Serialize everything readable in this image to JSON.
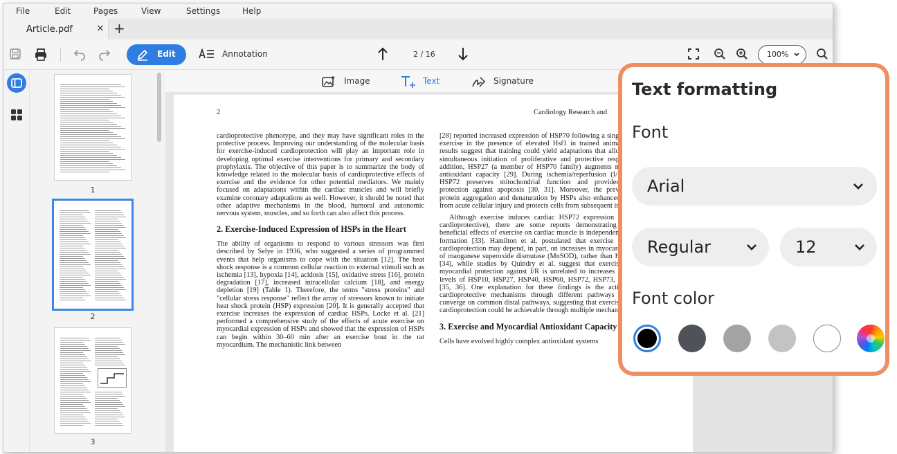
{
  "menu": [
    "File",
    "Edit",
    "Pages",
    "View",
    "Settings",
    "Help"
  ],
  "tab": {
    "title": "Article.pdf",
    "close": "×",
    "new": "+"
  },
  "toolbar": {
    "edit_label": "Edit",
    "annotation_label": "Annotation",
    "page_indicator": "2 / 16",
    "zoom": "100%"
  },
  "thumbnails": [
    {
      "num": "1"
    },
    {
      "num": "2"
    },
    {
      "num": "3"
    }
  ],
  "subtoolbar": {
    "image": "Image",
    "text": "Text",
    "signature": "Signature"
  },
  "page": {
    "number": "2",
    "running_head": "Cardiology Research and",
    "left_col_p1": "cardioprotective phenotype, and they may have significant roles in the protective process. Improving our understanding of the molecular basis for exercise-induced cardioprotection will play an important role in developing optimal exercise interventions for primary and secondary prophylaxis. The objective of this paper is to summarize the body of knowledge related to the molecular basis of cardioprotective effects of exercise and the evidence for other potential mediators. We mainly focused on adaptations within the cardiac muscles and will briefly examine coronary adaptations as well. However, it should be noted that other adaptive mechanisms in the blood, humoral and autonomic nervous system, muscles, and so forth can also affect this process.",
    "left_heading": "2. Exercise-Induced Expression of HSPs in the Heart",
    "left_col_p2": "The ability of organisms to respond to various stressors was first described by Selye in 1936, who suggested a series of programmed events that help organisms to cope with the situation [12]. The heat shock response is a common cellular reaction to external stimuli such as ischemia [13], hypoxia [14], acidosis [15], oxidative stress [16], protein degradation [17], increased intracellular calcium [18], and energy depletion [19] (Table 1). Therefore, the terms \"stress proteins\" and \"cellular stress response\" reflect the array of stressors known to initiate heat shock protein (HSP) expression [20]. It is generally accepted that exercise increases the expression of cardiac HSPs. Locke et al. [21] performed a comprehensive study of the effects of acute exercise on myocardial expression of HSPs and showed that the expression of HSPs can begin within 30–60 min after an exercise bout in the rat myocardium. The mechanistic link between",
    "right_col_p1": "[28] reported increased expression of HSP70 following a single bout of exercise in the presence of elevated Hsf1 in trained animals. These results suggest that training could yield adaptations that allow for the simultaneous initiation of proliferative and protective responses. In addition, HSP27 (a member of HSP70 family) augments myocardial antioxidant capacity [29]. During ischemia/reperfusion (I/R) injury, HSP72 preserves mitochondrial function and provides cellular protection against apoptosis [30, 31]. Moreover, the prevention of protein aggregation and denaturation by HSPs also enhances recovery from acute cellular injury and protects cells from subsequent injury [32].",
    "right_col_p2": "Although exercise induces cardiac HSP72 expression (which is cardioprotective), there are some reports demonstrating that the beneficial effects of exercise on cardiac muscle is independent of HSPs formation [33]. Hamilton et al. postulated that exercise associated cardioprotection may depend, in part, on increases in myocardial levels of manganese superoxide dismutase (MnSOD), rather than HSP levels [34], while studies by Quindry et al. suggest that exercise-induced myocardial protection against I/R is unrelated to increases in cardiac levels of HSP10, HSP27, HSP40, HSP60, HSP72, HSP73, or HSP90 [35, 36]. One explanation for these findings is the activation of cardioprotective mechanisms through different pathways that then converge on common distal pathways, suggesting that exercise-induced cardioprotection could be achievable through multiple mechanisms.",
    "right_heading": "3. Exercise and Myocardial Antioxidant Capacity",
    "right_col_p3": "Cells have evolved highly complex antioxidant systems"
  },
  "panel": {
    "title": "Text formatting",
    "font_label": "Font",
    "font_value": "Arial",
    "style_value": "Regular",
    "size_value": "12",
    "color_label": "Font color",
    "swatches": [
      "#000000",
      "#4f5359",
      "#a3a3a3",
      "#c3c3c3",
      "#ffffff"
    ]
  },
  "colors": {
    "accent": "#2f7de1",
    "panel_border": "#ee8e63",
    "selected_thumb": "#3c88e6"
  }
}
